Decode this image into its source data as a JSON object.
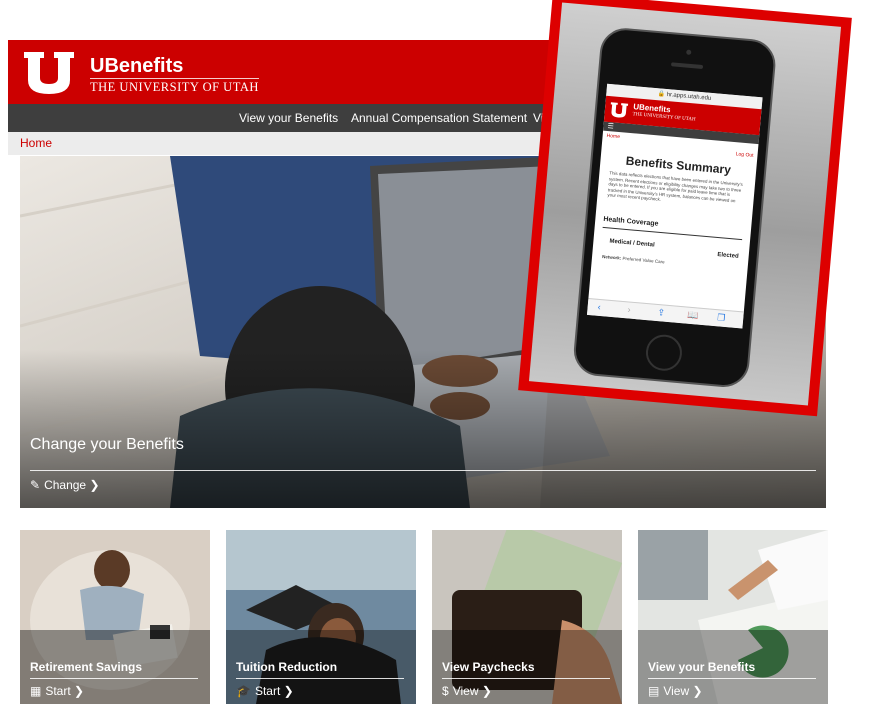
{
  "brand": {
    "title": "UBenefits",
    "subtitle": "THE UNIVERSITY OF UTAH",
    "accent": "#cc0000"
  },
  "nav": {
    "items": [
      "View your Benefits",
      "Annual Compensation Statement",
      "View Pay"
    ]
  },
  "breadcrumb": {
    "home": "Home"
  },
  "hero": {
    "title": "Change your Benefits",
    "link": "Change"
  },
  "tiles": [
    {
      "title": "Retirement Savings",
      "link": "Start",
      "icon": "calendar-icon"
    },
    {
      "title": "Tuition Reduction",
      "link": "Start",
      "icon": "graduation-cap-icon"
    },
    {
      "title": "View Paychecks",
      "link": "View",
      "icon": "dollar-icon"
    },
    {
      "title": "View your Benefits",
      "link": "View",
      "icon": "list-icon"
    }
  ],
  "phone": {
    "url": "hr.apps.utah.edu",
    "brand_title": "UBenefits",
    "brand_subtitle": "THE UNIVERSITY OF UTAH",
    "home": "Home",
    "logout": "Log Out",
    "heading": "Benefits Summary",
    "intro": "This data reflects elections that have been entered in the University's system. Recent elections or eligibility changes may take two to three days to be entered. If you are eligible for paid leave time that is tracked in the University's HR system, balances can be viewed on your most recent paycheck.",
    "section": "Health Coverage",
    "row_label": "Medical / Dental",
    "row_status": "Elected",
    "network_label": "Network:",
    "network_value": "Preferred Value Care"
  }
}
